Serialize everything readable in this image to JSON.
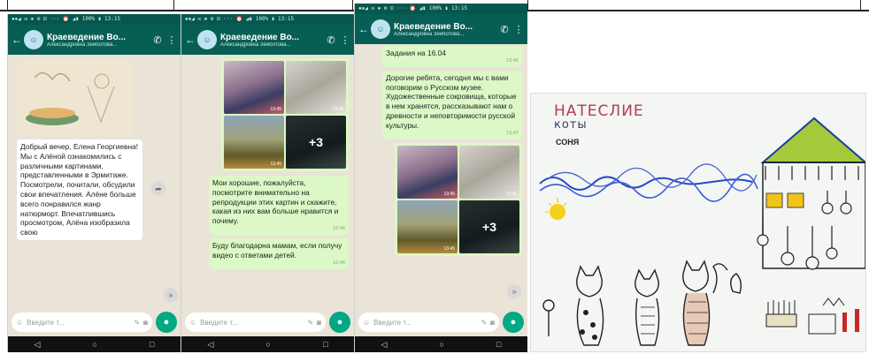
{
  "status_bar_text": "▪▪◢ ✉ ▪ ⚙ ⊡ ··· ⏰ ◢▮ 100% ▮ 13:15",
  "chat": {
    "title": "Краеведение Во...",
    "subtitle": "Александровна Зейботова...",
    "input_placeholder": "Введите т...",
    "call_icon": "call-icon",
    "menu_icon": "overflow-menu-icon"
  },
  "phone1": {
    "drawing_time": "",
    "message": "Добрый вечер, Елена Георгиевна! Мы с Алёной ознакомились с различными картинами, представленными в Эрмитаже. Посмотрели, почитали, обсудили свои впечатления. Алёне больше всего понравился жанр натюрморт. Впечатлившись просмотром, Алёна изобразила свою"
  },
  "phone2": {
    "thumb_times": [
      "13:45",
      "13:45",
      "13:45"
    ],
    "more_count": "+3",
    "message1": "Мои хорошие, пожалуйста, посмотрите внимательно на репродукции этих картин и скажите, какая из них вам больше нравится и почему.",
    "message1_time": "13:46",
    "message2": "Буду благодарна мамам, если получу видео с ответами детей.",
    "message2_time": "13:46"
  },
  "phone3": {
    "header_line": "Задания на 16.04",
    "header_time": "13:46",
    "message": "Дорогие ребята, сегодня мы с вами поговорим о Русском музее. Художественные сокровища, которые в нем хранятся, рассказывают нам о древности и неповторимости русской культуры.",
    "message_time": "13:47",
    "thumb_times": [
      "13:45",
      "13:45",
      "13:45"
    ],
    "more_count": "+3"
  },
  "drawing": {
    "title_line1": "НАТЕСЛИЕ",
    "title_line2": "коты",
    "signature": "СОНЯ"
  }
}
